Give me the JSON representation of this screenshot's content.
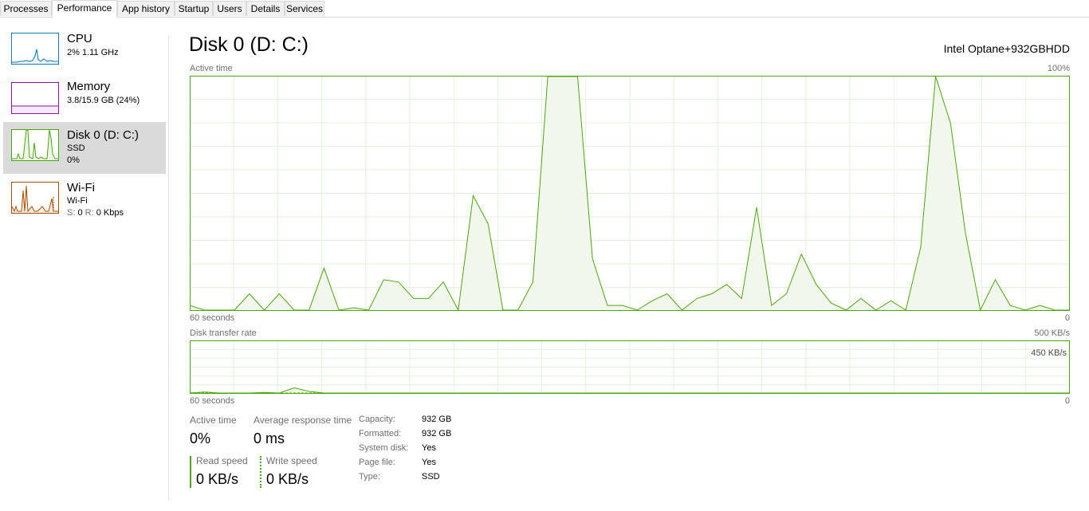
{
  "tabs": [
    {
      "label": "Processes",
      "active": false
    },
    {
      "label": "Performance",
      "active": true
    },
    {
      "label": "App history",
      "active": false
    },
    {
      "label": "Startup",
      "active": false
    },
    {
      "label": "Users",
      "active": false
    },
    {
      "label": "Details",
      "active": false
    },
    {
      "label": "Services",
      "active": false
    }
  ],
  "sidebar": {
    "cpu": {
      "title": "CPU",
      "line1": "2% 1.11 GHz",
      "color": "#117dbb"
    },
    "memory": {
      "title": "Memory",
      "line1": "3.8/15.9 GB (24%)",
      "color": "#8b12ae"
    },
    "disk": {
      "title": "Disk 0 (D: C:)",
      "line1": "SSD",
      "line2": "0%",
      "color": "#4da60c"
    },
    "wifi": {
      "title": "Wi-Fi",
      "line1": "Wi-Fi",
      "line2_prefix": "S:",
      "line2_s": "0",
      "line2_r_prefix": "R:",
      "line2_r": "0 Kbps",
      "color": "#a74f01"
    }
  },
  "main": {
    "title": "Disk 0 (D: C:)",
    "model": "Intel Optane+932GBHDD",
    "active_chart": {
      "label": "Active time",
      "max_label": "100%",
      "time_label": "60 seconds",
      "min_label": "0"
    },
    "transfer_chart": {
      "label": "Disk transfer rate",
      "max_label": "500 KB/s",
      "inner_label": "450 KB/s",
      "time_label": "60 seconds",
      "min_label": "0"
    },
    "stats": {
      "active_time_label": "Active time",
      "active_time_value": "0%",
      "avg_response_label": "Average response time",
      "avg_response_value": "0 ms",
      "read_label": "Read speed",
      "read_value": "0 KB/s",
      "write_label": "Write speed",
      "write_value": "0 KB/s"
    },
    "properties": [
      {
        "label": "Capacity:",
        "value": "932 GB"
      },
      {
        "label": "Formatted:",
        "value": "932 GB"
      },
      {
        "label": "System disk:",
        "value": "Yes"
      },
      {
        "label": "Page file:",
        "value": "Yes"
      },
      {
        "label": "Type:",
        "value": "SSD"
      }
    ]
  },
  "chart_data": [
    {
      "type": "area",
      "ylim": [
        0,
        100
      ],
      "xlim": [
        60,
        0
      ],
      "series": [
        {
          "values": [
            2,
            0,
            0,
            0,
            7,
            0,
            7,
            0,
            0,
            18,
            0,
            1,
            0,
            13,
            12,
            5,
            5,
            12,
            0,
            49,
            37,
            0,
            0,
            12,
            100,
            100,
            100,
            22,
            2,
            2,
            0,
            4,
            7,
            0,
            5,
            7,
            11,
            5,
            44,
            2,
            7,
            24,
            11,
            3,
            0,
            5,
            0,
            4,
            0,
            27,
            100,
            80,
            33,
            0,
            13,
            2,
            0,
            2,
            0,
            0
          ]
        }
      ]
    },
    {
      "type": "line",
      "ylim": [
        0,
        500
      ],
      "series": [
        {
          "values": [
            0,
            10,
            0,
            0,
            0,
            5,
            0,
            50,
            15,
            0,
            0,
            0,
            0,
            0,
            0,
            0,
            0,
            0,
            0,
            0,
            0,
            0,
            0,
            0,
            0,
            0,
            0,
            0,
            0,
            0,
            0,
            0,
            0,
            0,
            0,
            0,
            0,
            0,
            0,
            0,
            0,
            0,
            0,
            0,
            0,
            0,
            0,
            0,
            0,
            0,
            0,
            0,
            0,
            0,
            0,
            0,
            0,
            0,
            0,
            0
          ]
        },
        {
          "values": [
            0,
            0,
            0,
            0,
            0,
            0,
            0,
            0,
            0,
            0,
            0,
            0,
            0,
            0,
            0,
            0,
            0,
            0,
            0,
            0,
            0,
            0,
            0,
            0,
            0,
            0,
            0,
            0,
            0,
            0,
            0,
            0,
            0,
            0,
            0,
            0,
            0,
            0,
            0,
            0,
            0,
            0,
            0,
            0,
            0,
            0,
            0,
            0,
            0,
            0,
            0,
            0,
            0,
            0,
            0,
            0,
            0,
            0,
            0,
            0
          ]
        }
      ]
    }
  ]
}
